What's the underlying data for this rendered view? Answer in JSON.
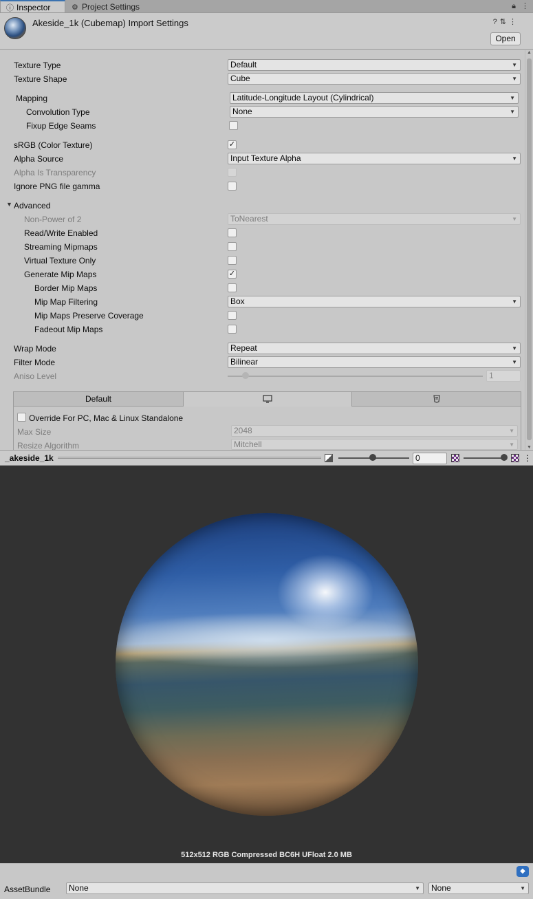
{
  "tabs": {
    "inspector": "Inspector",
    "project_settings": "Project Settings"
  },
  "header": {
    "title": "Akeside_1k (Cubemap) Import Settings",
    "open_label": "Open"
  },
  "props": {
    "texture_type": {
      "label": "Texture Type",
      "value": "Default"
    },
    "texture_shape": {
      "label": "Texture Shape",
      "value": "Cube"
    },
    "mapping": {
      "label": "Mapping",
      "value": "Latitude-Longitude Layout (Cylindrical)"
    },
    "convolution_type": {
      "label": "Convolution Type",
      "value": "None"
    },
    "fixup_edge_seams": {
      "label": "Fixup Edge Seams",
      "checked": false
    },
    "srgb": {
      "label": "sRGB (Color Texture)",
      "checked": true
    },
    "alpha_source": {
      "label": "Alpha Source",
      "value": "Input Texture Alpha"
    },
    "alpha_is_transparency": {
      "label": "Alpha Is Transparency",
      "checked": false
    },
    "ignore_png_gamma": {
      "label": "Ignore PNG file gamma",
      "checked": false
    },
    "advanced": {
      "label": "Advanced",
      "expanded": true
    },
    "non_power_of_2": {
      "label": "Non-Power of 2",
      "value": "ToNearest"
    },
    "read_write": {
      "label": "Read/Write Enabled",
      "checked": false
    },
    "streaming_mipmaps": {
      "label": "Streaming Mipmaps",
      "checked": false
    },
    "virtual_texture": {
      "label": "Virtual Texture Only",
      "checked": false
    },
    "generate_mips": {
      "label": "Generate Mip Maps",
      "checked": true
    },
    "border_mips": {
      "label": "Border Mip Maps",
      "checked": false
    },
    "mip_filtering": {
      "label": "Mip Map Filtering",
      "value": "Box"
    },
    "mip_preserve_coverage": {
      "label": "Mip Maps Preserve Coverage",
      "checked": false
    },
    "fadeout_mips": {
      "label": "Fadeout Mip Maps",
      "checked": false
    },
    "wrap_mode": {
      "label": "Wrap Mode",
      "value": "Repeat"
    },
    "filter_mode": {
      "label": "Filter Mode",
      "value": "Bilinear"
    },
    "aniso_level": {
      "label": "Aniso Level",
      "value": "1"
    }
  },
  "platform": {
    "tabs": [
      "Default"
    ],
    "override_label": "Override For PC, Mac & Linux Standalone",
    "override_checked": false,
    "max_size": {
      "label": "Max Size",
      "value": "2048"
    },
    "resize_algorithm": {
      "label": "Resize Algorithm",
      "value": "Mitchell"
    }
  },
  "preview": {
    "name": "_akeside_1k",
    "mip_value": "0",
    "info": "512x512  RGB Compressed BC6H UFloat   2.0 MB"
  },
  "assetbundle": {
    "label": "AssetBundle",
    "name": "None",
    "variant": "None"
  },
  "checkmark": "✓",
  "arrow": "▼",
  "foldout_arrow": "▼",
  "icons": [
    "gear-icon",
    "lock-icon",
    "more-icon",
    "help-icon",
    "presets-icon",
    "monitor-icon",
    "html5-icon",
    "tag-icon",
    "checker-icon",
    "exposure-icon"
  ]
}
